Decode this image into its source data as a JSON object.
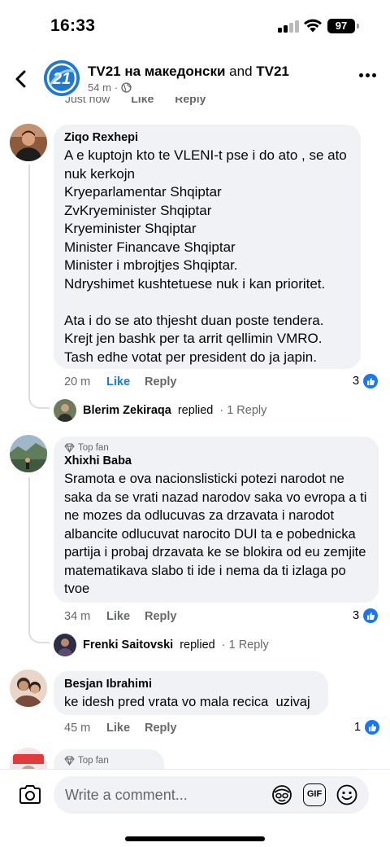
{
  "status_bar": {
    "time": "16:33",
    "battery": "97"
  },
  "header": {
    "title_page1": "TV21 на македонски",
    "title_and": " and ",
    "title_page2": "TV21",
    "meta_time": "54 m",
    "meta_separator": "·",
    "privacy_icon": "globe-icon",
    "logo_text": "21"
  },
  "cut_row": {
    "time": "Just now",
    "like": "Like",
    "reply": "Reply"
  },
  "comments": [
    {
      "author": "Ziqo Rexhepi",
      "text": "A e kuptojn kto te VLENI-t pse i do ato , se ato nuk kerkojn\nKryeparlamentar Shqiptar\nZvKryeminister Shqiptar\nKryeminister Shqiptar\nMinister Financave Shqiptar\nMinister i mbrojtjes Shqiptar.\nNdryshimet kushtetuese nuk i kan prioritet.\n\nAta i do se ato thjesht duan poste tendera.\nKrejt jen bashk per ta arrit qellimin VMRO.\nTash edhe votat per president do ja japin.",
      "time": "20 m",
      "like": "Like",
      "reply": "Reply",
      "reactions": "3",
      "replier": "Blerim Zekiraqa",
      "replied_text": "replied",
      "reply_count": "· 1 Reply"
    },
    {
      "badge": "Top fan",
      "author": "Xhixhi Baba",
      "text": "Sramota e ova nacionslisticki potezi narodot ne saka da se vrati nazad narodov saka vo evropa a ti ne mozes da odlucuvas za drzavata i narodot albancite odlucuvat narocito DUI ta e pobednicka partija i probaj drzavata ke se blokira od eu zemjite matematikava slabo ti ide i nema da ti izlaga po tvoe",
      "time": "34 m",
      "like": "Like",
      "reply": "Reply",
      "reactions": "3",
      "replier": "Frenki Saitovski",
      "replied_text": "replied",
      "reply_count": "· 1 Reply"
    },
    {
      "author": "Besjan Ibrahimi",
      "text": "ke idesh pred vrata vo mala recica  uzivaj",
      "time": "45 m",
      "like": "Like",
      "reply": "Reply",
      "reactions": "1"
    },
    {
      "badge": "Top fan"
    }
  ],
  "composer": {
    "placeholder": "Write a comment...",
    "gif_label": "GIF"
  },
  "colors": {
    "accent": "#1877f2",
    "bubble": "#f0f2f5",
    "muted": "#65676b"
  }
}
